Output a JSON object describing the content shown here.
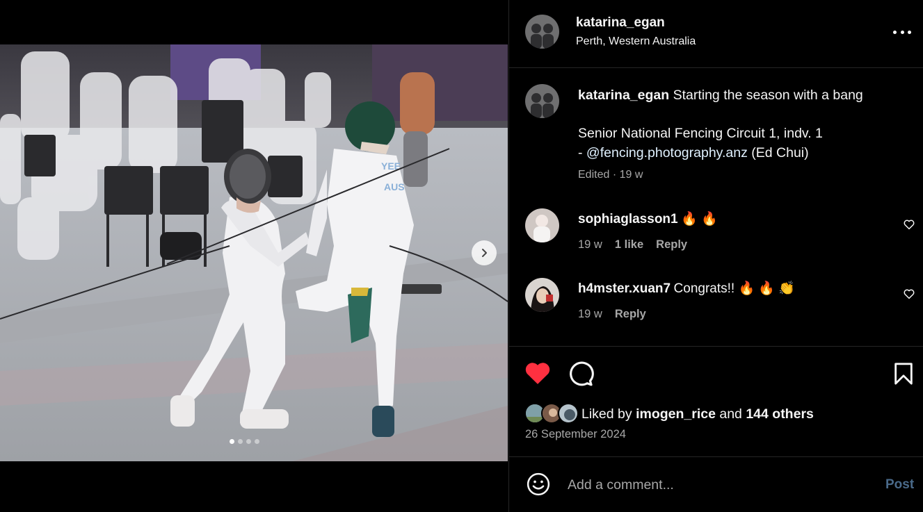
{
  "post": {
    "author": "katarina_egan",
    "location": "Perth, Western Australia",
    "caption_line1": "Starting the season with a bang",
    "caption_line2": "Senior National Fencing Circuit 1, indv. 1",
    "caption_line3_prefix": "- ",
    "caption_mention": "@fencing.photography.anz",
    "caption_line3_suffix": " (Ed Chui)",
    "meta": "Edited · 19 w",
    "photo_count": 4,
    "active_photo": 1
  },
  "comments": [
    {
      "user": "sophiaglasson1",
      "text": "🔥 🔥",
      "time": "19 w",
      "likes": "1 like",
      "reply": "Reply"
    },
    {
      "user": "h4mster.xuan7",
      "text": "Congrats!! 🔥 🔥 👏",
      "time": "19 w",
      "reply": "Reply"
    }
  ],
  "actions": {
    "liked_by_prefix": "Liked by ",
    "liked_by_user": "imogen_rice",
    "liked_by_mid": " and ",
    "liked_by_others": "144 others",
    "date": "26 September 2024"
  },
  "comment_box": {
    "placeholder": "Add a comment...",
    "post_label": "Post"
  },
  "colors": {
    "background": "#000000",
    "like_red": "#ff3040",
    "muted_text": "#a8a8a8",
    "post_button": "#4a6a8a"
  },
  "icons": [
    "chevron-right-icon",
    "more-icon",
    "heart-outline-icon",
    "heart-filled-icon",
    "comment-icon",
    "bookmark-icon",
    "emoji-icon"
  ]
}
